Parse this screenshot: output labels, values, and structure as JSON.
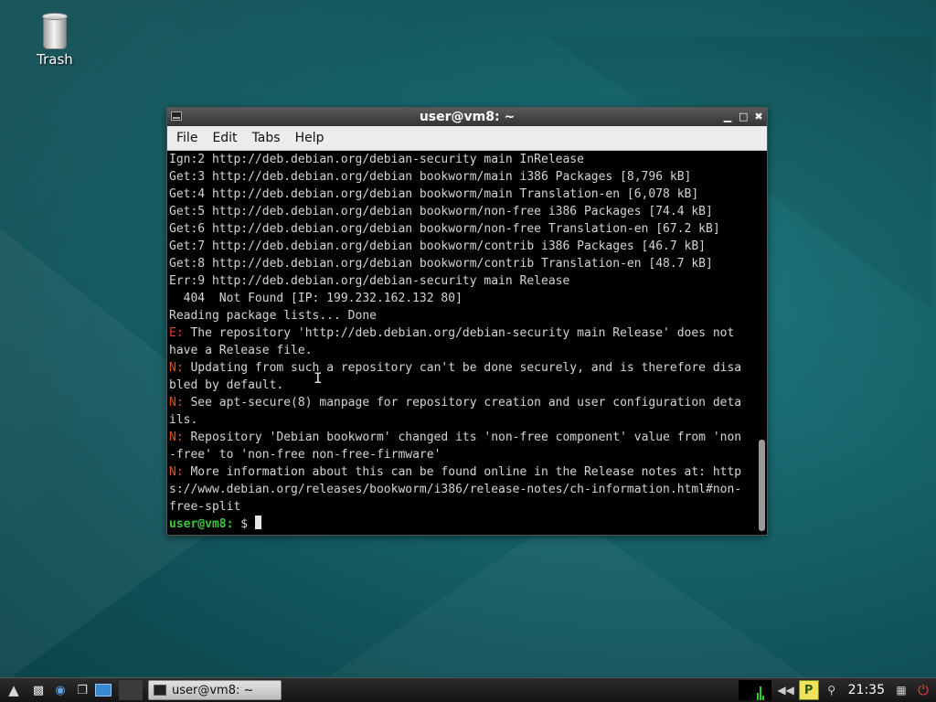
{
  "desktop": {
    "icons": [
      {
        "label": "Trash"
      }
    ]
  },
  "window": {
    "title": "user@vm8: ~",
    "menu": [
      "File",
      "Edit",
      "Tabs",
      "Help"
    ],
    "lines": [
      {
        "prefix": "",
        "text": "Ign:2 http://deb.debian.org/debian-security main InRelease"
      },
      {
        "prefix": "",
        "text": "Get:3 http://deb.debian.org/debian bookworm/main i386 Packages [8,796 kB]"
      },
      {
        "prefix": "",
        "text": "Get:4 http://deb.debian.org/debian bookworm/main Translation-en [6,078 kB]"
      },
      {
        "prefix": "",
        "text": "Get:5 http://deb.debian.org/debian bookworm/non-free i386 Packages [74.4 kB]"
      },
      {
        "prefix": "",
        "text": "Get:6 http://deb.debian.org/debian bookworm/non-free Translation-en [67.2 kB]"
      },
      {
        "prefix": "",
        "text": "Get:7 http://deb.debian.org/debian bookworm/contrib i386 Packages [46.7 kB]"
      },
      {
        "prefix": "",
        "text": "Get:8 http://deb.debian.org/debian bookworm/contrib Translation-en [48.7 kB]"
      },
      {
        "prefix": "",
        "text": "Err:9 http://deb.debian.org/debian-security main Release"
      },
      {
        "prefix": "",
        "text": "  404  Not Found [IP: 199.232.162.132 80]"
      },
      {
        "prefix": "",
        "text": "Reading package lists... Done"
      },
      {
        "prefix": "E:",
        "text": " The repository 'http://deb.debian.org/debian-security main Release' does not"
      },
      {
        "prefix": "",
        "text": "have a Release file."
      },
      {
        "prefix": "N:",
        "text": " Updating from such a repository can't be done securely, and is therefore disa"
      },
      {
        "prefix": "",
        "text": "bled by default."
      },
      {
        "prefix": "N:",
        "text": " See apt-secure(8) manpage for repository creation and user configuration deta"
      },
      {
        "prefix": "",
        "text": "ils."
      },
      {
        "prefix": "N:",
        "text": " Repository 'Debian bookworm' changed its 'non-free component' value from 'non"
      },
      {
        "prefix": "",
        "text": "-free' to 'non-free non-free-firmware'"
      },
      {
        "prefix": "N:",
        "text": " More information about this can be found online in the Release notes at: http"
      },
      {
        "prefix": "",
        "text": "s://www.debian.org/releases/bookworm/i386/release-notes/ch-information.html#non-"
      },
      {
        "prefix": "",
        "text": "free-split"
      }
    ],
    "prompt": {
      "user": "user@vm8:",
      "path": " $ "
    },
    "scroll_fraction": 0.8
  },
  "taskbar": {
    "tasks": [
      {
        "label": "user@vm8: ~"
      }
    ],
    "clock": "21:35",
    "tray_badge": "P"
  },
  "colors": {
    "error": "#e8372b",
    "note": "#d4531e",
    "prompt": "#3cc63c"
  }
}
